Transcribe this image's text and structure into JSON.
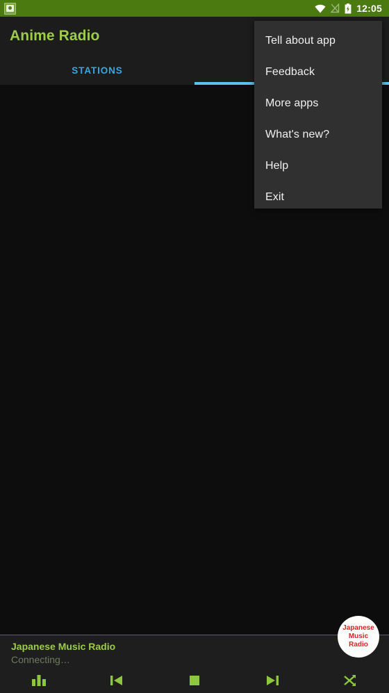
{
  "statusbar": {
    "notification_icon": "app-notification-icon",
    "wifi_icon": "wifi-icon",
    "signal_icon": "no-signal-icon",
    "battery_icon": "battery-charging-icon",
    "clock": "12:05"
  },
  "appbar": {
    "title": "Anime Radio",
    "title_color": "#9ccc4a",
    "background": "#1c1c1c"
  },
  "tabs": {
    "items": [
      {
        "label": "STATIONS",
        "selected": false,
        "color": "#39a7dd"
      },
      {
        "label": "",
        "selected": true,
        "color": "#8a8a8a"
      }
    ],
    "indicator_color": "#5ec0ee"
  },
  "menu": {
    "background": "#303030",
    "items": [
      {
        "label": "Tell about app"
      },
      {
        "label": "Feedback"
      },
      {
        "label": "More apps"
      },
      {
        "label": "What's new?"
      },
      {
        "label": "Help"
      },
      {
        "label": "Exit"
      }
    ]
  },
  "player": {
    "station_title": "Japanese Music Radio",
    "status": "Connecting…",
    "title_color": "#9ccc4a",
    "accent_color": "#8dc63f",
    "badge": {
      "line1": "Japanese",
      "line2": "Music",
      "line3": "Radio",
      "text_color": "#e81b23",
      "background": "#fdfdfb"
    },
    "controls": [
      {
        "name": "equalizer-icon",
        "label": "Equalizer"
      },
      {
        "name": "previous-icon",
        "label": "Previous"
      },
      {
        "name": "stop-icon",
        "label": "Stop"
      },
      {
        "name": "next-icon",
        "label": "Next"
      },
      {
        "name": "shuffle-icon",
        "label": "Shuffle"
      }
    ]
  }
}
